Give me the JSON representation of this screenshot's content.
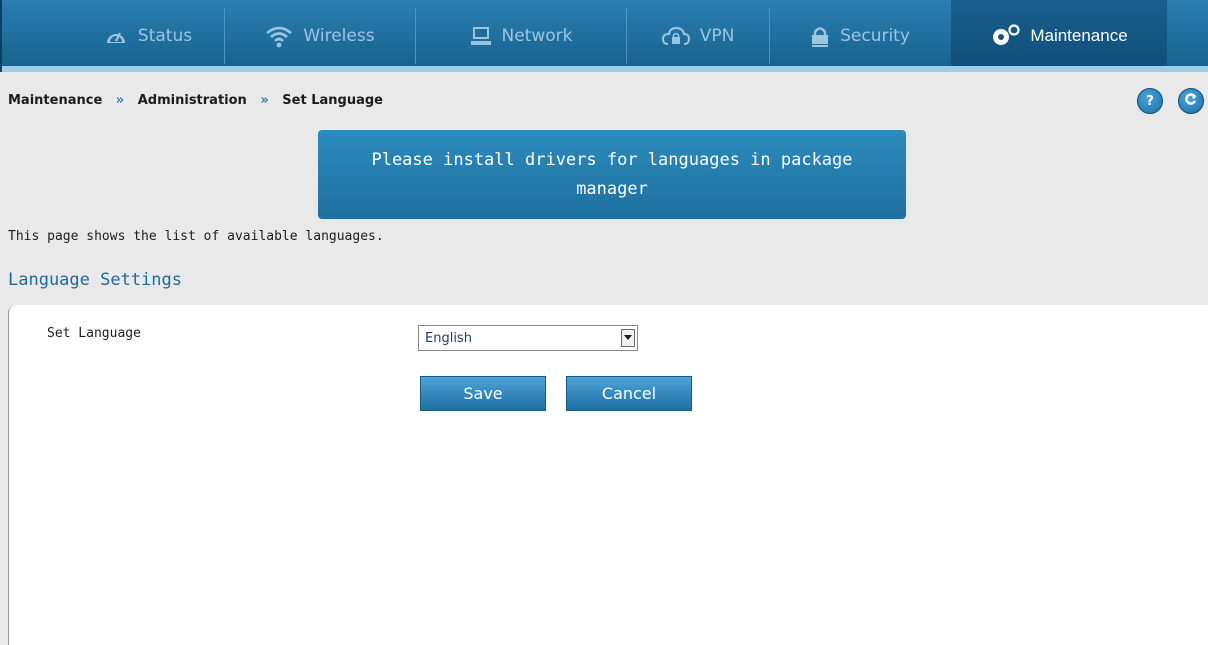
{
  "nav": {
    "tabs": [
      {
        "label": "Status",
        "icon": "dashboard-gauge-icon"
      },
      {
        "label": "Wireless",
        "icon": "wifi-icon"
      },
      {
        "label": "Network",
        "icon": "computer-icon"
      },
      {
        "label": "VPN",
        "icon": "cloud-lock-icon"
      },
      {
        "label": "Security",
        "icon": "lock-icon"
      },
      {
        "label": "Maintenance",
        "icon": "gears-icon",
        "active": true
      }
    ]
  },
  "breadcrumb": [
    "Maintenance",
    "Administration",
    "Set Language"
  ],
  "breadcrumb_separator": "»",
  "help_button": "?",
  "notice": "Please install drivers for languages in package manager",
  "page_description": "This page shows the list of available languages.",
  "section_title": "Language Settings",
  "form": {
    "label": "Set Language",
    "selected": "English"
  },
  "buttons": {
    "save": "Save",
    "cancel": "Cancel"
  },
  "colors": {
    "nav_bg": "#1f6e9d",
    "accent": "#2a7fb0",
    "page_bg": "#e9e9e9"
  }
}
